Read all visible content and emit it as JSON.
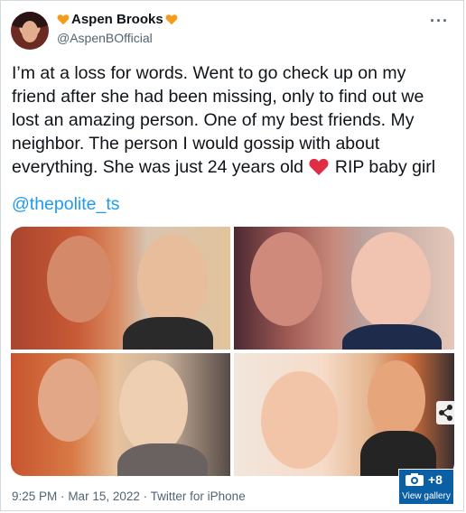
{
  "author": {
    "name": "Aspen Brooks",
    "handle": "@AspenBOfficial",
    "heart_color": "#f59c1c"
  },
  "tweet": {
    "text_before_emoji": "I’m at a loss for words. Went to go check up on my friend after she had been missing, only to find out we lost an amazing person. One of my best friends. My neighbor. The person I would gossip with about everything. She was just 24 years old",
    "text_after_emoji": " RIP baby girl",
    "emoji": "red-heart",
    "mention": "@thepolite_ts"
  },
  "media": {
    "photo_count": 4,
    "gallery_count_label": "+8",
    "gallery_label": "View gallery"
  },
  "footer": {
    "time": "9:25 PM",
    "date": "Mar 15, 2022",
    "source": "Twitter for iPhone",
    "separator": "·"
  },
  "more_label": "···"
}
